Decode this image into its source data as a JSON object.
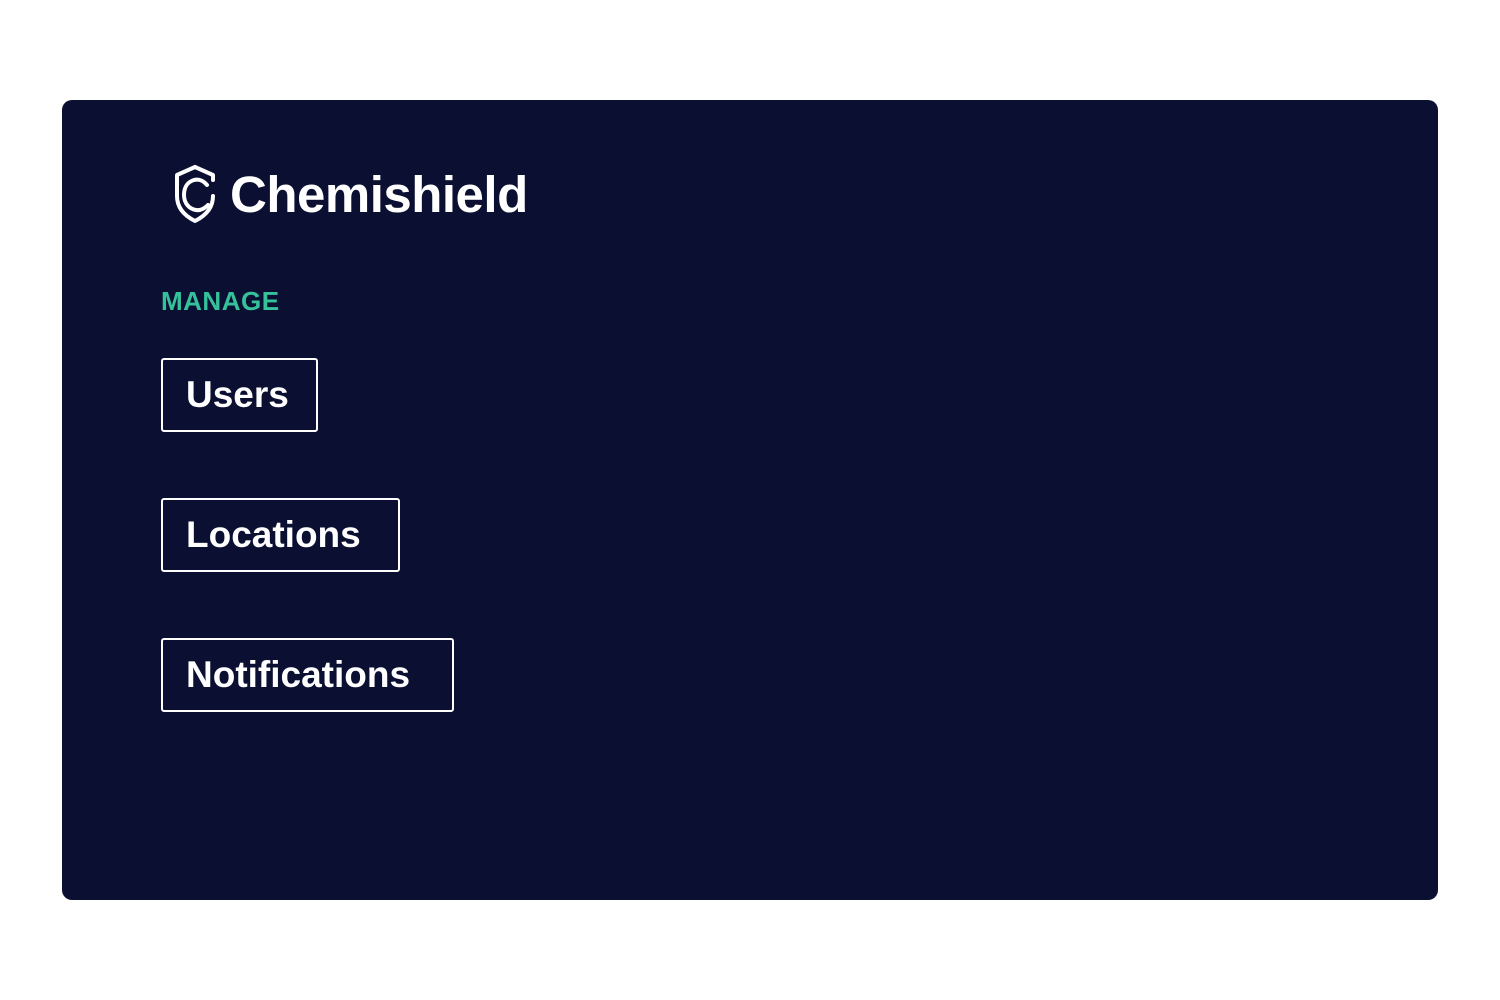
{
  "brand": {
    "name": "Chemishield",
    "icon": "shield-c-logo-icon"
  },
  "nav": {
    "section_label": "MANAGE",
    "items": [
      {
        "label": "Users"
      },
      {
        "label": "Locations"
      },
      {
        "label": "Notifications"
      }
    ]
  },
  "colors": {
    "panel_background": "#0b1033",
    "accent": "#35c29b",
    "text": "#ffffff",
    "page_background": "#ffffff"
  }
}
